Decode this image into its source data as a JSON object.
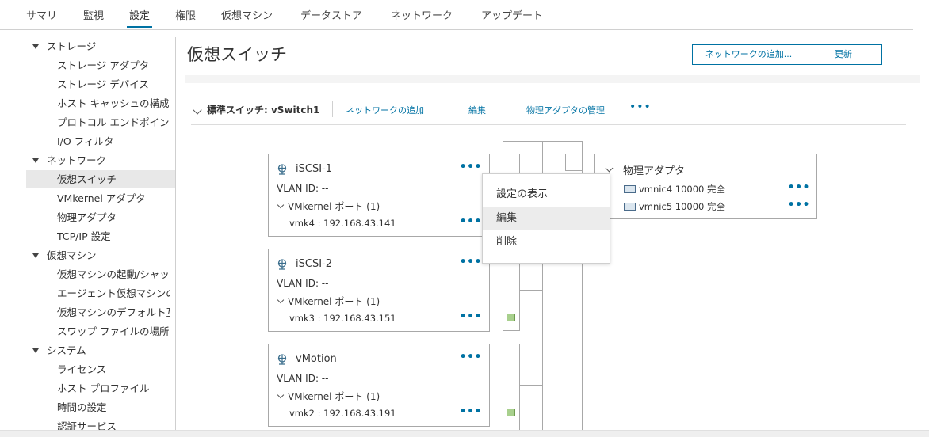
{
  "tabs": [
    "サマリ",
    "監視",
    "設定",
    "権限",
    "仮想マシン",
    "データストア",
    "ネットワーク",
    "アップデート"
  ],
  "active_tab": "設定",
  "sidebar": {
    "storage": {
      "label": "ストレージ",
      "items": [
        "ストレージ アダプタ",
        "ストレージ デバイス",
        "ホスト キャッシュの構成",
        "プロトコル エンドポイント",
        "I/O フィルタ"
      ]
    },
    "network": {
      "label": "ネットワーク",
      "items": [
        "仮想スイッチ",
        "VMkernel アダプタ",
        "物理アダプタ",
        "TCP/IP 設定"
      ]
    },
    "vm": {
      "label": "仮想マシン",
      "items": [
        "仮想マシンの起動/シャットダウン",
        "エージェント仮想マシンの設定",
        "仮想マシンのデフォルト互換性",
        "スワップ ファイルの場所"
      ]
    },
    "system": {
      "label": "システム",
      "items": [
        "ライセンス",
        "ホスト プロファイル",
        "時間の設定",
        "認証サービス"
      ]
    },
    "selected": "仮想スイッチ"
  },
  "page": {
    "title": "仮想スイッチ",
    "add_network_button": "ネットワークの追加...",
    "refresh_button": "更新"
  },
  "switch": {
    "title": "標準スイッチ: vSwitch1",
    "actions": {
      "add_network": "ネットワークの追加",
      "edit": "編集",
      "manage_adapters": "物理アダプタの管理",
      "more": "•••"
    }
  },
  "port_groups": [
    {
      "name": "iSCSI-1",
      "vlan": "VLAN ID: --",
      "vmkernel": "VMkernel ポート (1)",
      "vmk": "vmk4 : 192.168.43.141"
    },
    {
      "name": "iSCSI-2",
      "vlan": "VLAN ID: --",
      "vmkernel": "VMkernel ポート (1)",
      "vmk": "vmk3 : 192.168.43.151"
    },
    {
      "name": "vMotion",
      "vlan": "VLAN ID: --",
      "vmkernel": "VMkernel ポート (1)",
      "vmk": "vmk2 : 192.168.43.191"
    }
  ],
  "physical_adapters": {
    "title": "物理アダプタ",
    "items": [
      "vmnic4 10000 完全",
      "vmnic5 10000 完全"
    ]
  },
  "context_menu": {
    "items": [
      "設定の表示",
      "編集",
      "削除"
    ],
    "highlighted": "編集"
  },
  "more_glyph": "•••",
  "colors": {
    "accent": "#0072a3",
    "selected_bg": "#e8e8e8",
    "port_green": "#a8d08d"
  }
}
